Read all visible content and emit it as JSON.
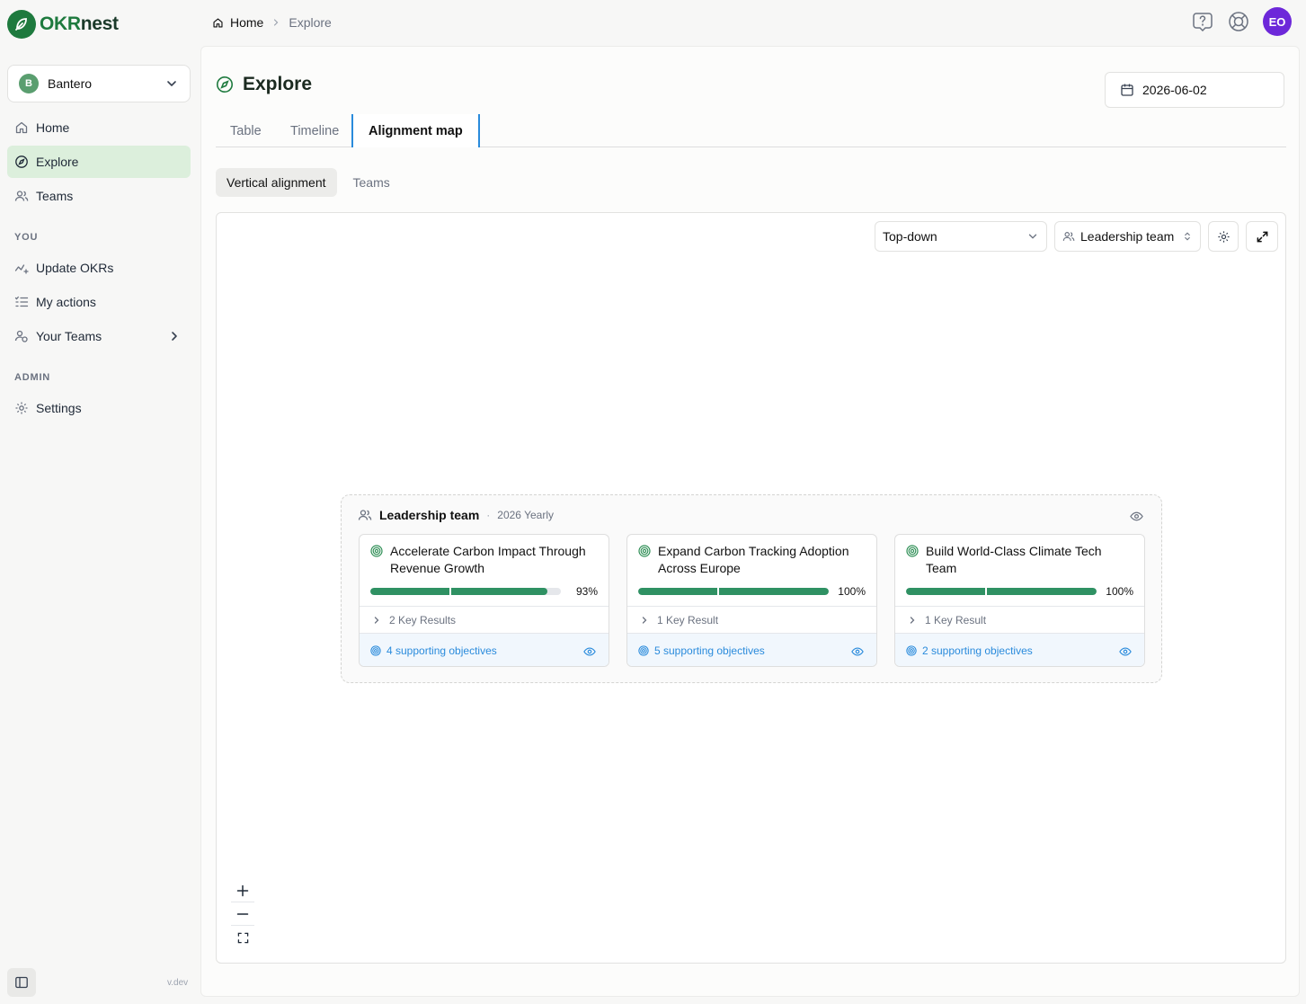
{
  "app": {
    "logo_okr": "OKR",
    "logo_nest": "nest"
  },
  "sidebar": {
    "org": {
      "initial": "B",
      "name": "Bantero"
    },
    "items_main": [
      {
        "label": "Home",
        "icon": "home-icon"
      },
      {
        "label": "Explore",
        "icon": "compass-icon"
      },
      {
        "label": "Teams",
        "icon": "users-icon"
      }
    ],
    "section_you": "YOU",
    "items_you": [
      {
        "label": "Update OKRs",
        "icon": "activity-icon"
      },
      {
        "label": "My actions",
        "icon": "list-check-icon"
      },
      {
        "label": "Your Teams",
        "icon": "user-group-icon"
      }
    ],
    "section_admin": "ADMIN",
    "items_admin": [
      {
        "label": "Settings",
        "icon": "gear-icon"
      }
    ],
    "version": "v.dev"
  },
  "breadcrumb": {
    "home": "Home",
    "current": "Explore"
  },
  "user": {
    "initials": "EO"
  },
  "page": {
    "title": "Explore",
    "date": "2026-06-02"
  },
  "tabs": [
    "Table",
    "Timeline",
    "Alignment map"
  ],
  "subtabs": [
    "Vertical alignment",
    "Teams"
  ],
  "controls": {
    "direction": "Top-down",
    "team": "Leadership team"
  },
  "group": {
    "name": "Leadership team",
    "separator": "·",
    "period": "2026 Yearly",
    "cards": [
      {
        "title": "Accelerate Carbon Impact Through Revenue Growth",
        "progress": 93,
        "progress_label": "93%",
        "key_results": "2 Key Results",
        "supporting": "4 supporting objectives"
      },
      {
        "title": "Expand Carbon Tracking Adoption Across Europe",
        "progress": 100,
        "progress_label": "100%",
        "key_results": "1 Key Result",
        "supporting": "5 supporting objectives"
      },
      {
        "title": "Build World-Class Climate Tech Team",
        "progress": 100,
        "progress_label": "100%",
        "key_results": "1 Key Result",
        "supporting": "2 supporting objectives"
      }
    ]
  },
  "colors": {
    "brand": "#1e7a3e",
    "progress": "#2f9163",
    "link": "#2a8bdc",
    "avatar": "#6d28d9"
  }
}
